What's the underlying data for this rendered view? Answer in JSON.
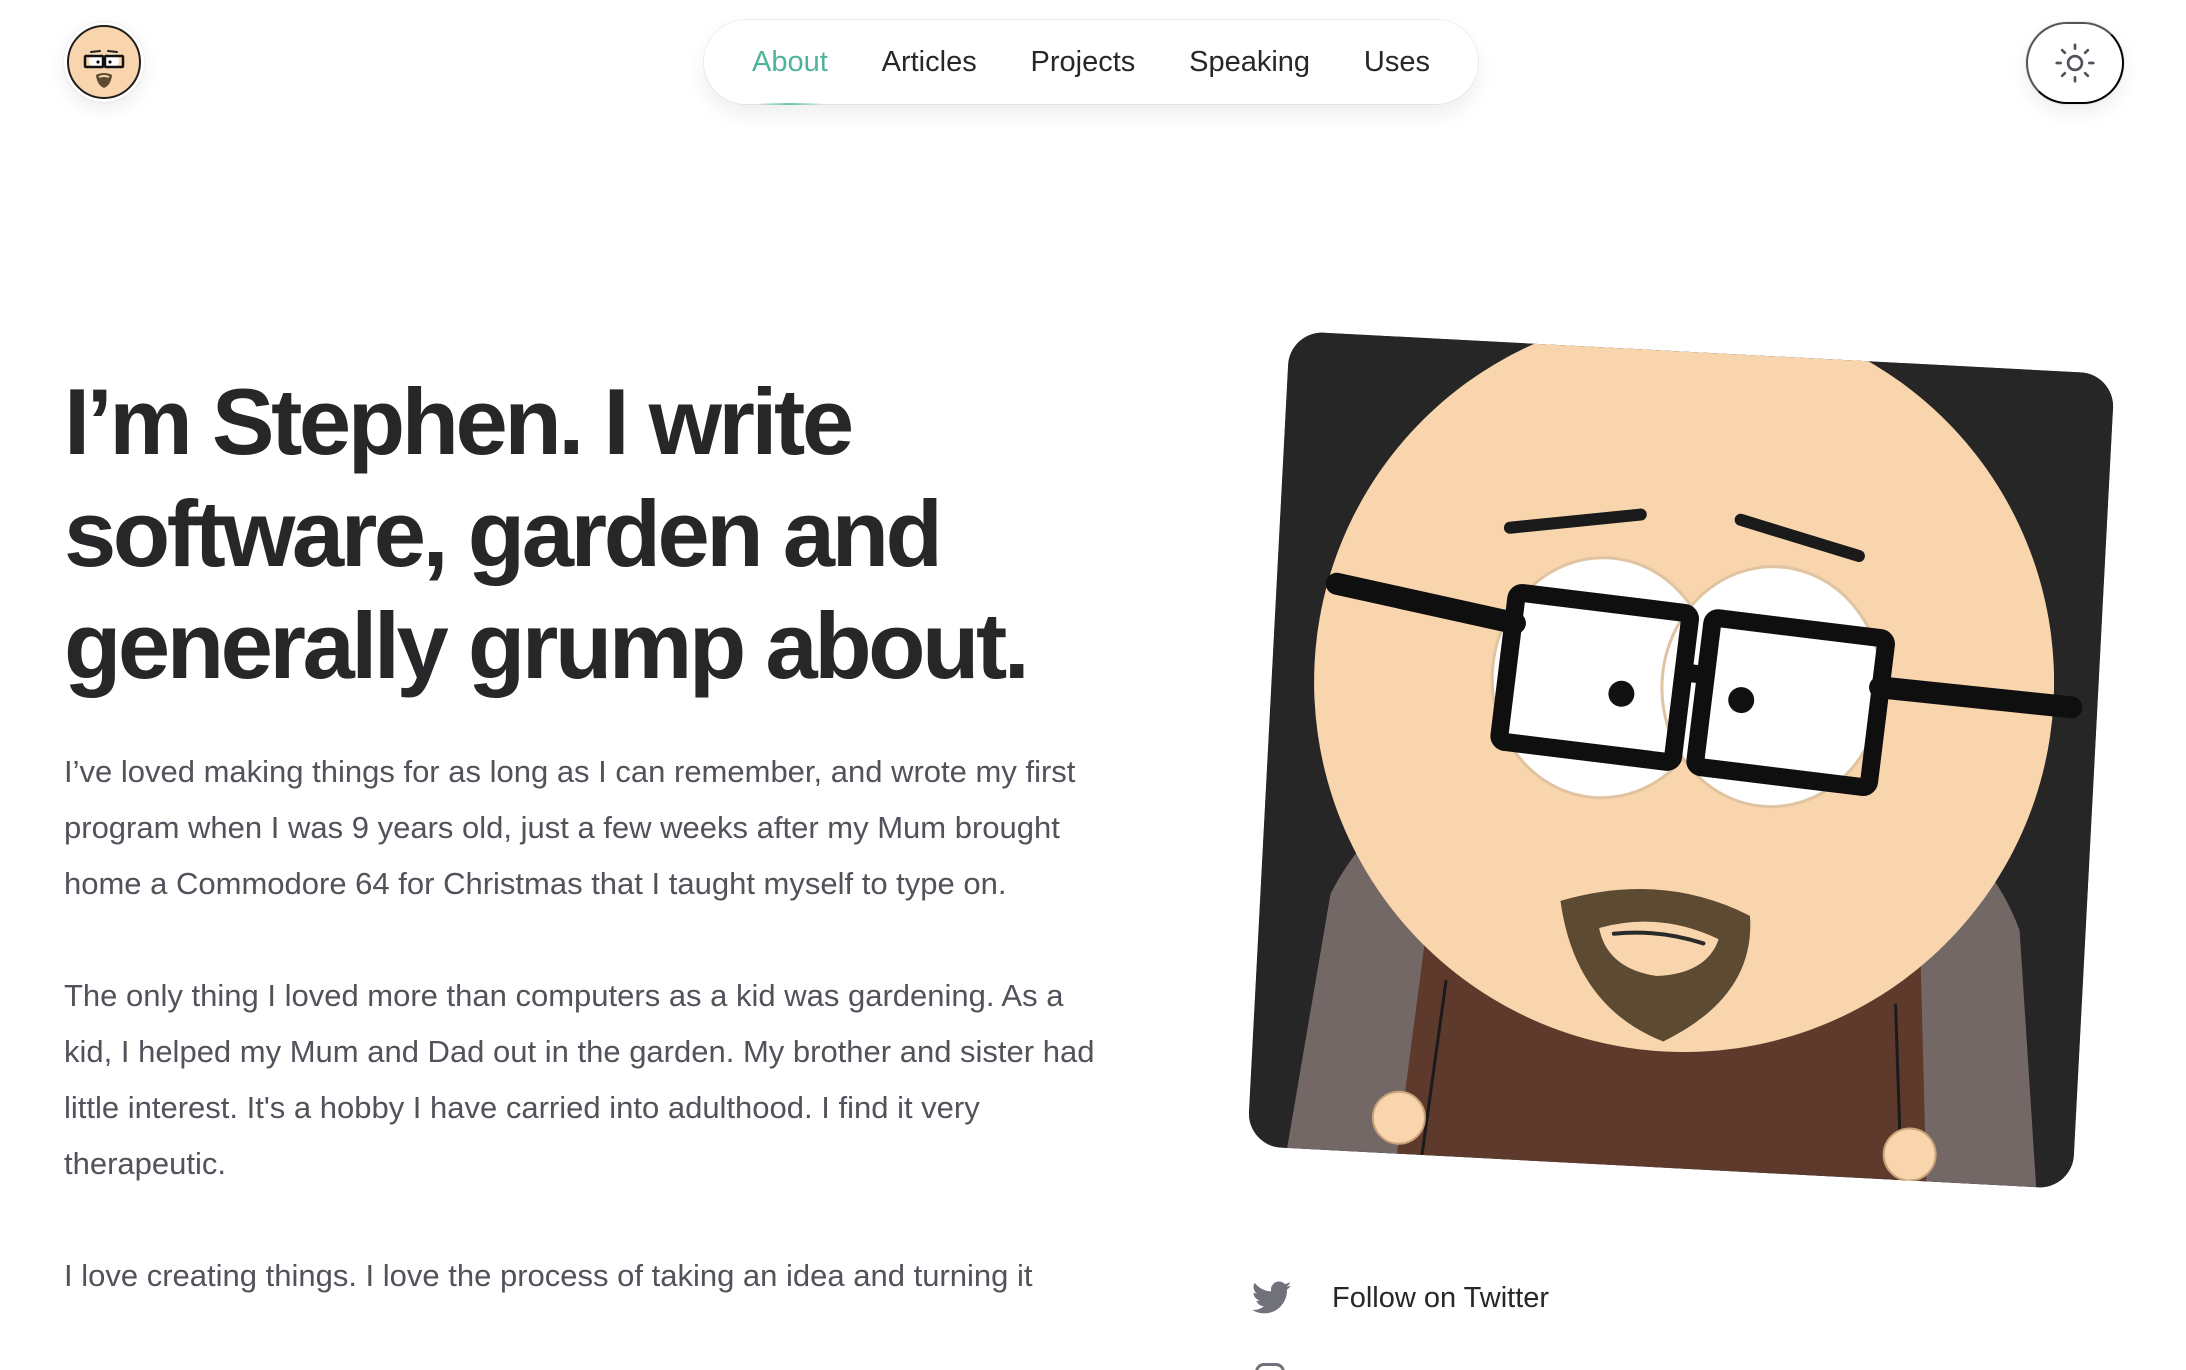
{
  "nav": {
    "items": [
      {
        "label": "About",
        "active": true
      },
      {
        "label": "Articles",
        "active": false
      },
      {
        "label": "Projects",
        "active": false
      },
      {
        "label": "Speaking",
        "active": false
      },
      {
        "label": "Uses",
        "active": false
      }
    ]
  },
  "icons": {
    "avatar": "cartoon-avatar-icon",
    "theme_toggle": "sun-icon",
    "twitter": "twitter-icon",
    "instagram": "instagram-icon"
  },
  "hero": {
    "title": "I’m Stephen. I write software, garden and generally grump about."
  },
  "bio": {
    "paragraphs": [
      "I’ve loved making things for as long as I can remember, and wrote my first program when I was 9 years old, just a few weeks after my Mum brought home a Commodore 64 for Christmas that I taught myself to type on.",
      "The only thing I loved more than computers as a kid was gardening. As a kid, I helped my Mum and Dad out in the garden. My brother and sister had little interest. It's a hobby I have carried into adulthood. I find it very therapeutic.",
      "I love creating things. I love the process of taking an idea and turning it"
    ]
  },
  "social": {
    "twitter_label": "Follow on Twitter"
  },
  "colors": {
    "accent": "#4fb39b",
    "text": "#27272a",
    "muted_text": "#52525b",
    "skin": "#f8d5ad",
    "beard": "#5c4a32",
    "shirt": "#5e3a2c",
    "backdrop": "#262626"
  }
}
